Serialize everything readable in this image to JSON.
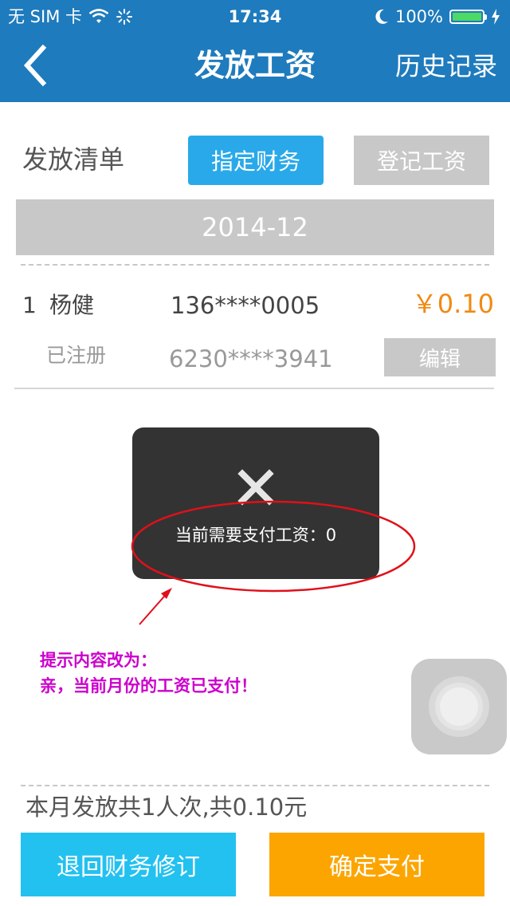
{
  "status_bar": {
    "carrier": "无 SIM 卡",
    "time": "17:34",
    "battery": "100%"
  },
  "nav": {
    "title": "发放工资",
    "right_label": "历史记录"
  },
  "list": {
    "label": "发放清单",
    "assign_finance_label": "指定财务",
    "register_salary_label": "登记工资",
    "period": "2014-12"
  },
  "employees": [
    {
      "index": "1",
      "name": "杨健",
      "phone": "136****0005",
      "amount": "￥0.10",
      "status": "已注册",
      "card": "6230****3941",
      "edit_label": "编辑"
    }
  ],
  "toast": {
    "message": "当前需要支付工资：0"
  },
  "annotation": {
    "line1": "提示内容改为：",
    "line2": "亲，当前月份的工资已支付！"
  },
  "footer": {
    "summary": "本月发放共1人次,共0.10元",
    "return_label": "退回财务修订",
    "confirm_label": "确定支付"
  },
  "colors": {
    "nav_bg": "#1e7bbd",
    "primary_blue": "#29a9ea",
    "amount_orange": "#f08a14",
    "confirm_orange": "#fca500",
    "annotation_magenta": "#cc00cc",
    "annotation_red": "#e0101a"
  }
}
